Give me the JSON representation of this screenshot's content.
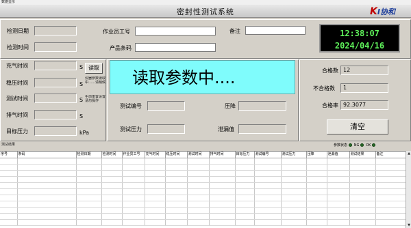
{
  "window": {
    "title": "数据显示"
  },
  "header": {
    "title": "密封性测试系统",
    "logo_k": "K",
    "logo_rest": "I协和"
  },
  "info": {
    "test_date_label": "检测日期",
    "test_date_value": "",
    "test_time_label": "检测时间",
    "test_time_value": "",
    "operator_label": "作业员工号",
    "operator_value": "",
    "barcode_label": "产品条码",
    "barcode_value": "",
    "remark_label": "备注",
    "remark_value": ""
  },
  "clock": {
    "time": "12:38:07",
    "date": "2024/04/16"
  },
  "params": {
    "fill_time_label": "充气时间",
    "fill_time_unit": "S",
    "stable_time_label": "稳压时间",
    "stable_time_unit": "S",
    "test_time_label": "测试时间",
    "test_time_unit": "S",
    "exhaust_time_label": "排气时间",
    "exhaust_time_unit": "S",
    "target_pressure_label": "目标压力",
    "target_pressure_unit": "kPa",
    "read_button": "读取",
    "note1": "仪器参数读取中……请稍候",
    "note2": "手动重置设置请勿操作"
  },
  "status": {
    "banner": "读取参数中...."
  },
  "measure": {
    "test_no_label": "测试编号",
    "pressure_label": "压降",
    "test_pressure_label": "测试压力",
    "leak_value_label": "泄漏值"
  },
  "stats": {
    "pass_label": "合格数",
    "pass_value": "12",
    "fail_label": "不合格数",
    "fail_value": "1",
    "rate_label": "合格率",
    "rate_value": "92.3077",
    "clear_button": "清空"
  },
  "grid": {
    "title": "测试结果",
    "led1": "参数状态",
    "led2": "NG",
    "led3": "OK",
    "columns": [
      "序号",
      "条码",
      "检测日期",
      "检测时间",
      "作业员工号",
      "充气时间",
      "稳压时间",
      "测试时间",
      "排气时间",
      "目标压力",
      "测试编号",
      "测试压力",
      "压降",
      "泄漏值",
      "测试结果",
      "备注"
    ]
  },
  "colors": {
    "clock_text": "#5ef05a",
    "banner_bg": "#7ffcfc",
    "logo_red": "#c00000",
    "logo_blue": "#1d3d9a"
  }
}
